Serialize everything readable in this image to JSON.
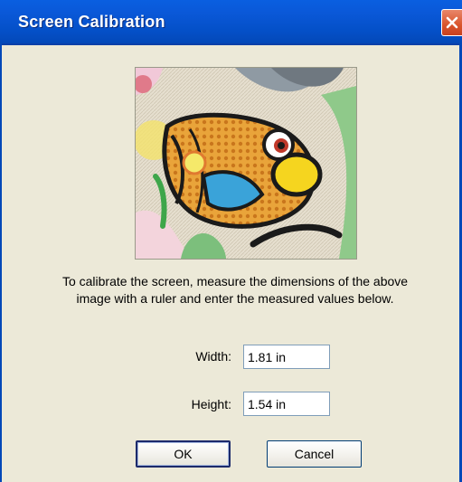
{
  "window": {
    "title": "Screen Calibration"
  },
  "instruction": {
    "line1": "To calibrate the screen, measure the dimensions of the above",
    "line2": "image with a ruler and enter the measured values below."
  },
  "fields": {
    "width_label": "Width:",
    "width_value": "1.81 in",
    "height_label": "Height:",
    "height_value": "1.54 in"
  },
  "buttons": {
    "ok_label": "OK",
    "cancel_label": "Cancel"
  },
  "colors": {
    "titlebar": "#0450c8",
    "dialog_bg": "#ece9d8",
    "close_button": "#d9542c"
  },
  "icons": {
    "close": "close-icon"
  }
}
